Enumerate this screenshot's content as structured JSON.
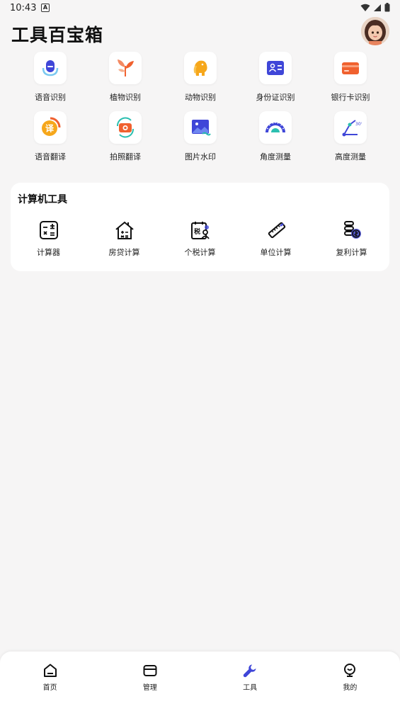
{
  "status": {
    "time": "10:43"
  },
  "header": {
    "title": "工具百宝箱"
  },
  "tools_row1": [
    {
      "label": "语音识别",
      "icon": "microphone-icon"
    },
    {
      "label": "植物识别",
      "icon": "plant-icon"
    },
    {
      "label": "动物识别",
      "icon": "elephant-icon"
    },
    {
      "label": "身份证识别",
      "icon": "id-card-icon"
    },
    {
      "label": "银行卡识别",
      "icon": "bank-card-icon"
    }
  ],
  "tools_row2": [
    {
      "label": "语音翻译",
      "icon": "voice-translate-icon",
      "glyph": "译"
    },
    {
      "label": "拍照翻译",
      "icon": "camera-translate-icon"
    },
    {
      "label": "图片水印",
      "icon": "picture-watermark-icon"
    },
    {
      "label": "角度测量",
      "icon": "protractor-icon"
    },
    {
      "label": "高度测量",
      "icon": "height-measure-icon",
      "glyph": "30°"
    }
  ],
  "calculator": {
    "title": "计算机工具",
    "items": [
      {
        "label": "计算器",
        "icon": "calculator-icon"
      },
      {
        "label": "房贷计算",
        "icon": "mortgage-icon"
      },
      {
        "label": "个税计算",
        "icon": "tax-icon",
        "glyph": "税"
      },
      {
        "label": "单位计算",
        "icon": "ruler-icon"
      },
      {
        "label": "复利计算",
        "icon": "compound-interest-icon"
      }
    ]
  },
  "nav": [
    {
      "label": "首页",
      "icon": "home-icon"
    },
    {
      "label": "管理",
      "icon": "folder-icon"
    },
    {
      "label": "工具",
      "icon": "wrench-icon",
      "active": true
    },
    {
      "label": "我的",
      "icon": "profile-icon"
    }
  ],
  "colors": {
    "accent": "#3f46d8",
    "orange": "#f0612f",
    "background": "#f6f5f5"
  }
}
